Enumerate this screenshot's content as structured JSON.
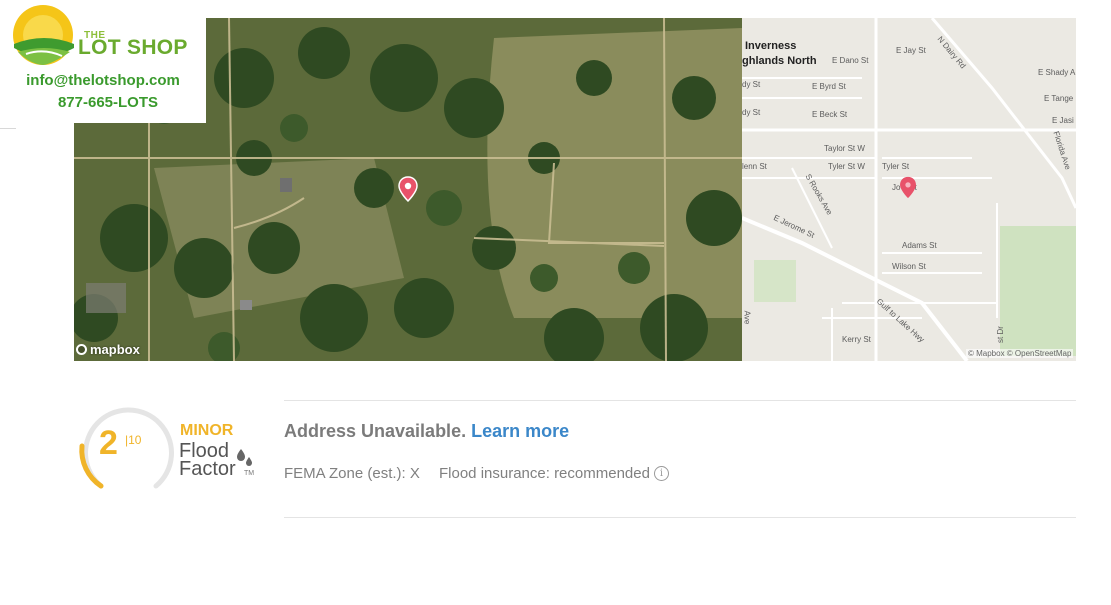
{
  "logo": {
    "the": "THE",
    "name": "LOT SHOP",
    "email": "info@thelotshop.com",
    "phone": "877-665-LOTS",
    "colors": {
      "sun": "#f5c518",
      "green": "#3a9a2d",
      "light_green": "#8dbf3a"
    }
  },
  "maps": {
    "satellite_credit": "mapbox",
    "street_attribution": "© Mapbox © OpenStreetMap",
    "marker_icon": "map-pin-icon",
    "marker_color": "#e8526a",
    "places": [
      "Inverness",
      "ghlands North"
    ],
    "streets": [
      "E Jay St",
      "N Dairy Rd",
      "E Dano St",
      "E Shady A",
      "E Tange",
      "E Jasi",
      "dy St",
      "E Byrd St",
      "E Beck St",
      "Taylor St W",
      "Tyler St W",
      "Tyler St",
      "lenn St",
      "Jo    n St",
      "S Rooks Ave",
      "E Jerome St",
      "Adams St",
      "Wilson St",
      "Florida Ave",
      "Gulf to Lake Hwy",
      "Kerry St",
      "st Dr",
      "Ave",
      "St"
    ]
  },
  "flood": {
    "score": "2",
    "scale": "|10",
    "risk_label": "MINOR",
    "brand_line1": "Flood",
    "brand_line2": "Factor",
    "trademark": "TM",
    "risk_color": "#f0b429",
    "address_status": "Address Unavailable.",
    "learn_more": "Learn more",
    "fema_zone": "FEMA Zone (est.): X",
    "insurance": "Flood insurance: recommended",
    "info_symbol": "i"
  }
}
